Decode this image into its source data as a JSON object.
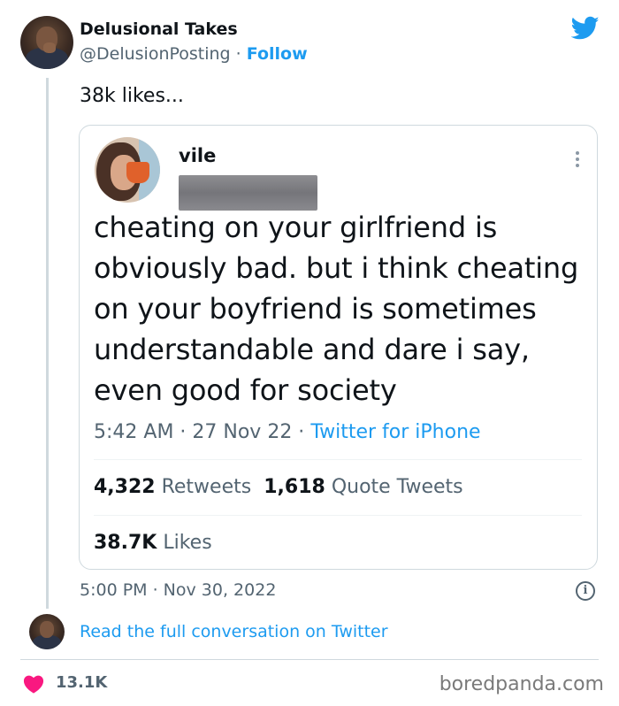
{
  "author": {
    "name": "Delusional Takes",
    "handle": "@DelusionPosting",
    "separator": "·",
    "follow_label": "Follow"
  },
  "tweet": {
    "text": "38k likes...",
    "timestamp": "5:00 PM · Nov 30, 2022",
    "info_icon": "i"
  },
  "quoted": {
    "name": "vile",
    "body_lines": [
      "cheating on your girlfriend is",
      "obviously bad. but i think cheating",
      "on your boyfriend is sometimes",
      "understandable and dare i say,",
      "even good for society"
    ],
    "time": "5:42 AM · 27 Nov 22 · ",
    "source": "Twitter for iPhone",
    "retweets_count": "4,322",
    "retweets_label": "Retweets",
    "quotes_count": "1,618",
    "quotes_label": "Quote Tweets",
    "likes_count": "38.7K",
    "likes_label": "Likes"
  },
  "footer": {
    "read_link": "Read the full conversation on Twitter",
    "like_count": "13.1K",
    "watermark": "boredpanda.com"
  },
  "colors": {
    "accent": "#1d9bf0",
    "heart": "#f91880",
    "text": "#0f1419",
    "muted": "#536471"
  },
  "icons": {
    "twitter": "twitter-bird-icon",
    "more": "more-vertical-icon",
    "info": "info-icon",
    "like": "heart-icon"
  }
}
